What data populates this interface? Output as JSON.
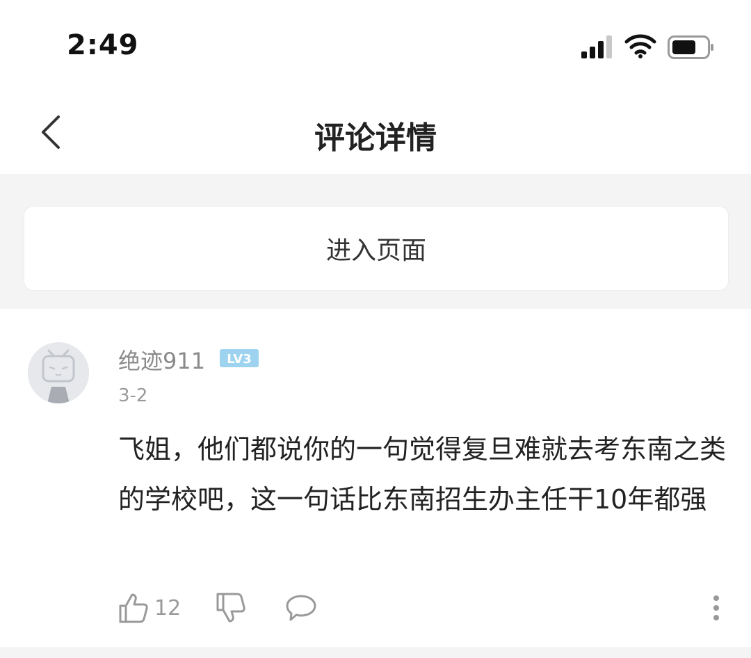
{
  "status_bar": {
    "time": "2:49",
    "icons": [
      "signal-icon",
      "wifi-icon",
      "battery-icon"
    ]
  },
  "nav": {
    "title": "评论详情",
    "back_icon": "chevron-left-icon"
  },
  "enter_page": {
    "label": "进入页面"
  },
  "comment": {
    "username": "绝迹911",
    "level": "LV3",
    "date": "3-2",
    "text": "飞姐，他们都说你的一句觉得复旦难就去考东南之类的学校吧，这一句话比东南招生办主任干10年都强",
    "like_count": "12",
    "icons": [
      "like-icon",
      "dislike-icon",
      "reply-icon",
      "more-icon"
    ]
  },
  "colors": {
    "background": "#ffffff",
    "gray_bg": "#f4f4f4",
    "text_primary": "#222222",
    "text_secondary": "#8a8a8a",
    "level_badge": "#9ed3ef"
  }
}
